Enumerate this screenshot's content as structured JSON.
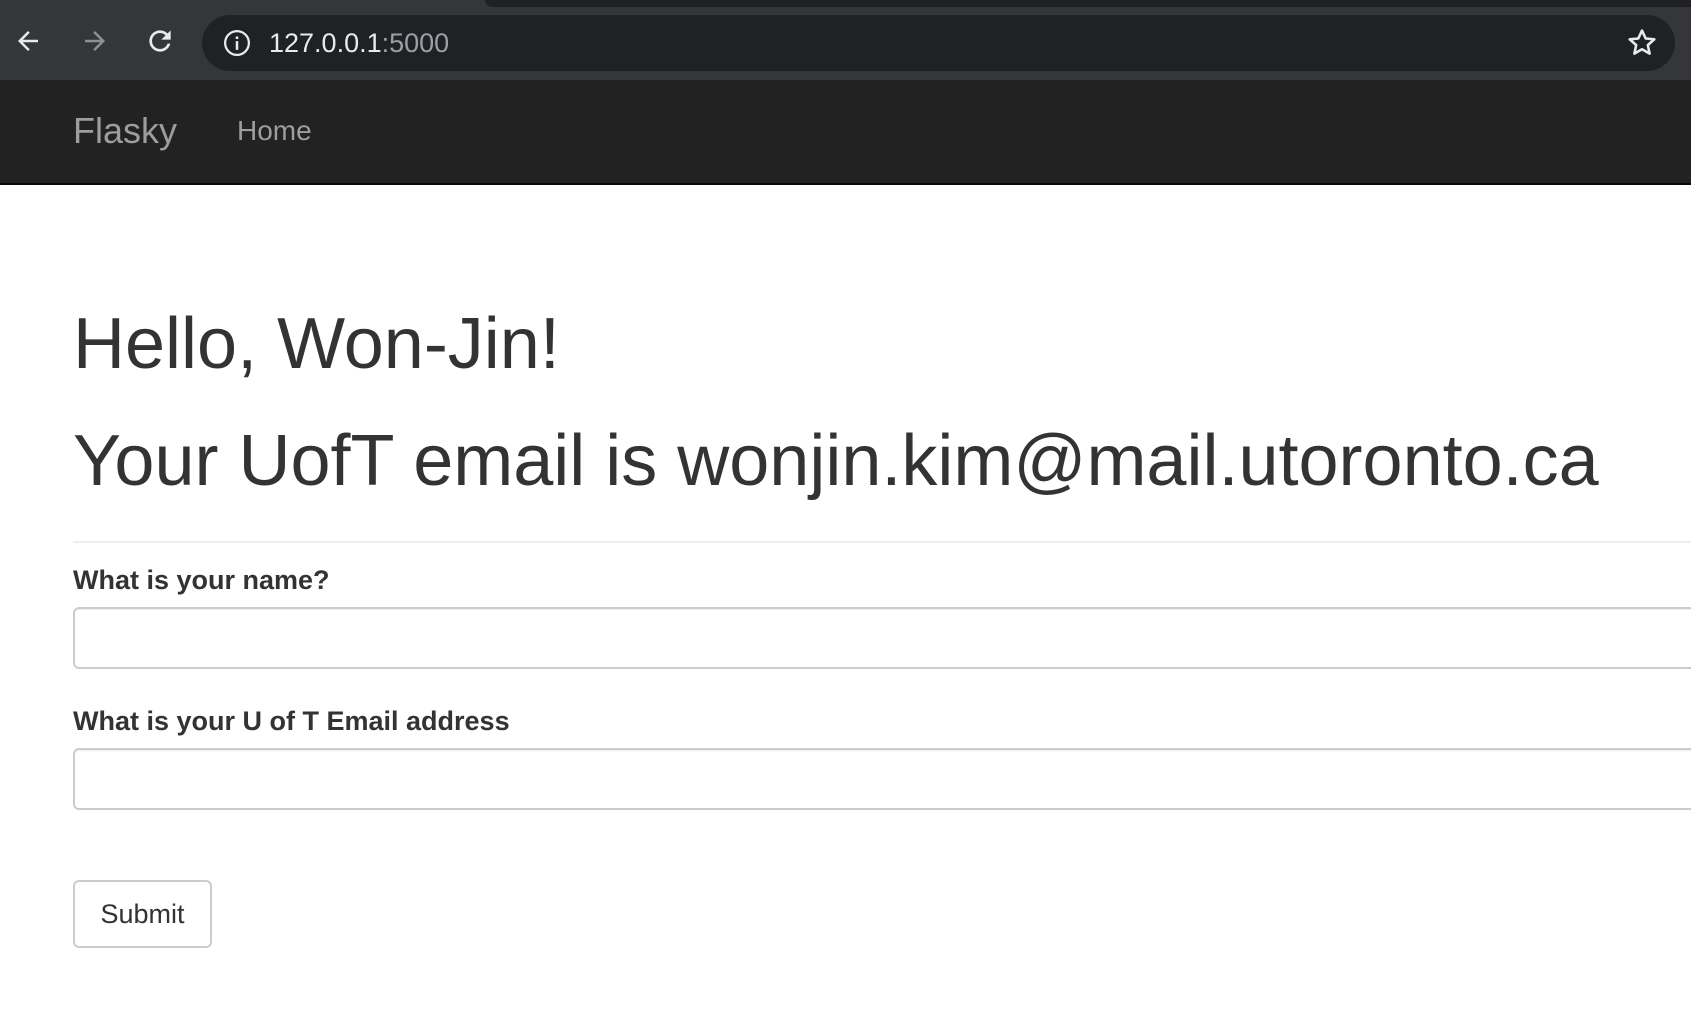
{
  "browser": {
    "url_host": "127.0.0.1",
    "url_port": ":5000",
    "icons": {
      "back": "back-arrow-icon",
      "forward": "forward-arrow-icon",
      "reload": "reload-icon",
      "site_info": "info-icon",
      "bookmark": "star-icon"
    }
  },
  "navbar": {
    "brand": "Flasky",
    "links": [
      {
        "label": "Home"
      }
    ]
  },
  "main": {
    "greeting": "Hello, Won-Jin!",
    "email_line": "Your UofT email is wonjin.kim@mail.utoronto.ca"
  },
  "form": {
    "name_label": "What is your name?",
    "name_value": "",
    "email_label": "What is your U of T Email address",
    "email_value": "",
    "submit_label": "Submit"
  },
  "colors": {
    "navbar_bg": "#222222",
    "navbar_text": "#9d9d9d",
    "chrome_bg": "#35363a",
    "omnibox_bg": "#202124",
    "heading_text": "#333333"
  }
}
